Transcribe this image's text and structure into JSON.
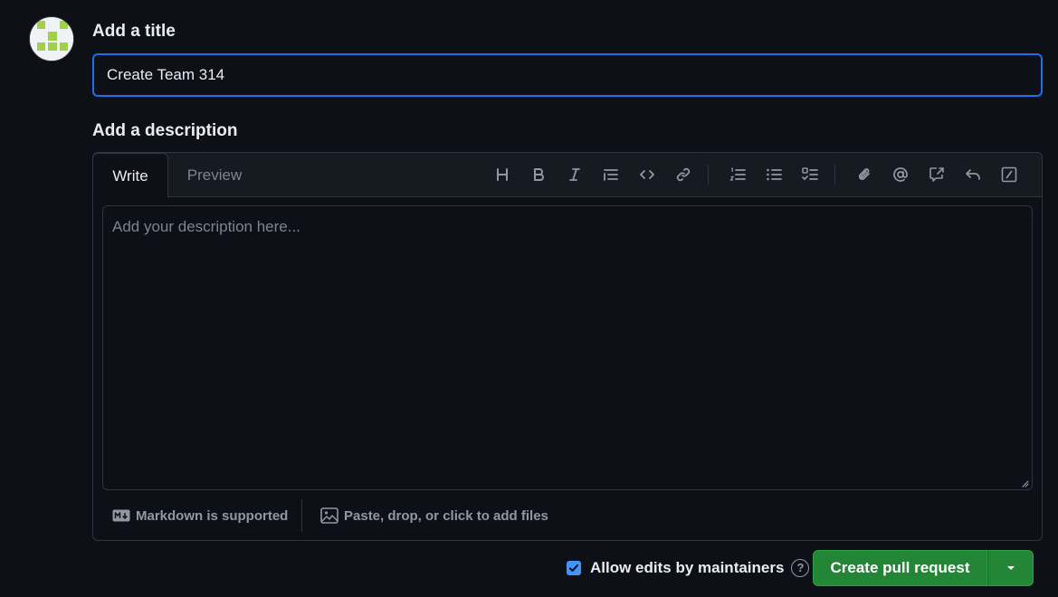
{
  "form": {
    "title_label": "Add a title",
    "title_value": "Create Team 314",
    "description_label": "Add a description"
  },
  "editor": {
    "tabs": [
      {
        "label": "Write",
        "active": true
      },
      {
        "label": "Preview",
        "active": false
      }
    ],
    "toolbar_icons": [
      "heading-icon",
      "bold-icon",
      "italic-icon",
      "quote-icon",
      "code-icon",
      "link-icon",
      "ordered-list-icon",
      "unordered-list-icon",
      "task-list-icon",
      "attach-icon",
      "mention-icon",
      "cross-reference-icon",
      "reply-icon",
      "slash-commands-icon"
    ],
    "placeholder": "Add your description here...",
    "markdown_note": "Markdown is supported",
    "files_note": "Paste, drop, or click to add files"
  },
  "actions": {
    "allow_edits_label": "Allow edits by maintainers",
    "allow_edits_checked": true,
    "help_glyph": "?",
    "submit_label": "Create pull request"
  },
  "colors": {
    "background": "#0d1117",
    "accent_blue": "#1f6feb",
    "button_green": "#238636",
    "avatar_green": "#a2d149"
  }
}
